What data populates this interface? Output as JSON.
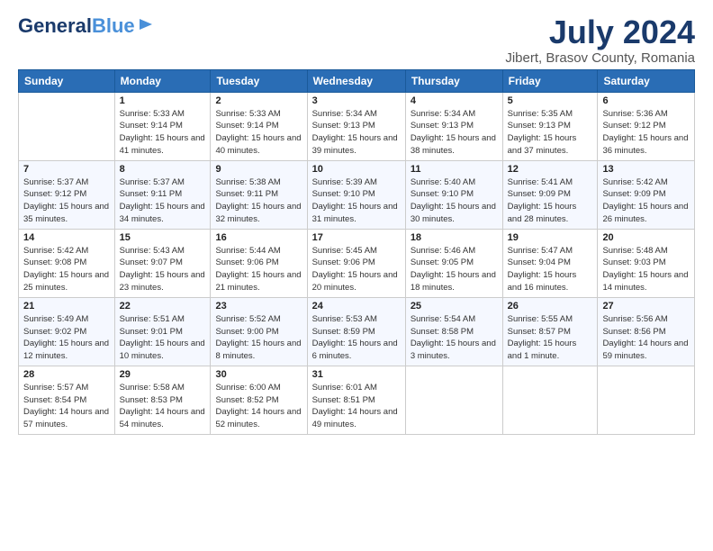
{
  "logo": {
    "general": "General",
    "blue": "Blue",
    "tagline": ""
  },
  "header": {
    "month": "July 2024",
    "location": "Jibert, Brasov County, Romania"
  },
  "weekdays": [
    "Sunday",
    "Monday",
    "Tuesday",
    "Wednesday",
    "Thursday",
    "Friday",
    "Saturday"
  ],
  "weeks": [
    [
      {
        "day": "",
        "data": ""
      },
      {
        "day": "1",
        "data": "Sunrise: 5:33 AM\nSunset: 9:14 PM\nDaylight: 15 hours\nand 41 minutes."
      },
      {
        "day": "2",
        "data": "Sunrise: 5:33 AM\nSunset: 9:14 PM\nDaylight: 15 hours\nand 40 minutes."
      },
      {
        "day": "3",
        "data": "Sunrise: 5:34 AM\nSunset: 9:13 PM\nDaylight: 15 hours\nand 39 minutes."
      },
      {
        "day": "4",
        "data": "Sunrise: 5:34 AM\nSunset: 9:13 PM\nDaylight: 15 hours\nand 38 minutes."
      },
      {
        "day": "5",
        "data": "Sunrise: 5:35 AM\nSunset: 9:13 PM\nDaylight: 15 hours\nand 37 minutes."
      },
      {
        "day": "6",
        "data": "Sunrise: 5:36 AM\nSunset: 9:12 PM\nDaylight: 15 hours\nand 36 minutes."
      }
    ],
    [
      {
        "day": "7",
        "data": "Sunrise: 5:37 AM\nSunset: 9:12 PM\nDaylight: 15 hours\nand 35 minutes."
      },
      {
        "day": "8",
        "data": "Sunrise: 5:37 AM\nSunset: 9:11 PM\nDaylight: 15 hours\nand 34 minutes."
      },
      {
        "day": "9",
        "data": "Sunrise: 5:38 AM\nSunset: 9:11 PM\nDaylight: 15 hours\nand 32 minutes."
      },
      {
        "day": "10",
        "data": "Sunrise: 5:39 AM\nSunset: 9:10 PM\nDaylight: 15 hours\nand 31 minutes."
      },
      {
        "day": "11",
        "data": "Sunrise: 5:40 AM\nSunset: 9:10 PM\nDaylight: 15 hours\nand 30 minutes."
      },
      {
        "day": "12",
        "data": "Sunrise: 5:41 AM\nSunset: 9:09 PM\nDaylight: 15 hours\nand 28 minutes."
      },
      {
        "day": "13",
        "data": "Sunrise: 5:42 AM\nSunset: 9:09 PM\nDaylight: 15 hours\nand 26 minutes."
      }
    ],
    [
      {
        "day": "14",
        "data": "Sunrise: 5:42 AM\nSunset: 9:08 PM\nDaylight: 15 hours\nand 25 minutes."
      },
      {
        "day": "15",
        "data": "Sunrise: 5:43 AM\nSunset: 9:07 PM\nDaylight: 15 hours\nand 23 minutes."
      },
      {
        "day": "16",
        "data": "Sunrise: 5:44 AM\nSunset: 9:06 PM\nDaylight: 15 hours\nand 21 minutes."
      },
      {
        "day": "17",
        "data": "Sunrise: 5:45 AM\nSunset: 9:06 PM\nDaylight: 15 hours\nand 20 minutes."
      },
      {
        "day": "18",
        "data": "Sunrise: 5:46 AM\nSunset: 9:05 PM\nDaylight: 15 hours\nand 18 minutes."
      },
      {
        "day": "19",
        "data": "Sunrise: 5:47 AM\nSunset: 9:04 PM\nDaylight: 15 hours\nand 16 minutes."
      },
      {
        "day": "20",
        "data": "Sunrise: 5:48 AM\nSunset: 9:03 PM\nDaylight: 15 hours\nand 14 minutes."
      }
    ],
    [
      {
        "day": "21",
        "data": "Sunrise: 5:49 AM\nSunset: 9:02 PM\nDaylight: 15 hours\nand 12 minutes."
      },
      {
        "day": "22",
        "data": "Sunrise: 5:51 AM\nSunset: 9:01 PM\nDaylight: 15 hours\nand 10 minutes."
      },
      {
        "day": "23",
        "data": "Sunrise: 5:52 AM\nSunset: 9:00 PM\nDaylight: 15 hours\nand 8 minutes."
      },
      {
        "day": "24",
        "data": "Sunrise: 5:53 AM\nSunset: 8:59 PM\nDaylight: 15 hours\nand 6 minutes."
      },
      {
        "day": "25",
        "data": "Sunrise: 5:54 AM\nSunset: 8:58 PM\nDaylight: 15 hours\nand 3 minutes."
      },
      {
        "day": "26",
        "data": "Sunrise: 5:55 AM\nSunset: 8:57 PM\nDaylight: 15 hours\nand 1 minute."
      },
      {
        "day": "27",
        "data": "Sunrise: 5:56 AM\nSunset: 8:56 PM\nDaylight: 14 hours\nand 59 minutes."
      }
    ],
    [
      {
        "day": "28",
        "data": "Sunrise: 5:57 AM\nSunset: 8:54 PM\nDaylight: 14 hours\nand 57 minutes."
      },
      {
        "day": "29",
        "data": "Sunrise: 5:58 AM\nSunset: 8:53 PM\nDaylight: 14 hours\nand 54 minutes."
      },
      {
        "day": "30",
        "data": "Sunrise: 6:00 AM\nSunset: 8:52 PM\nDaylight: 14 hours\nand 52 minutes."
      },
      {
        "day": "31",
        "data": "Sunrise: 6:01 AM\nSunset: 8:51 PM\nDaylight: 14 hours\nand 49 minutes."
      },
      {
        "day": "",
        "data": ""
      },
      {
        "day": "",
        "data": ""
      },
      {
        "day": "",
        "data": ""
      }
    ]
  ]
}
